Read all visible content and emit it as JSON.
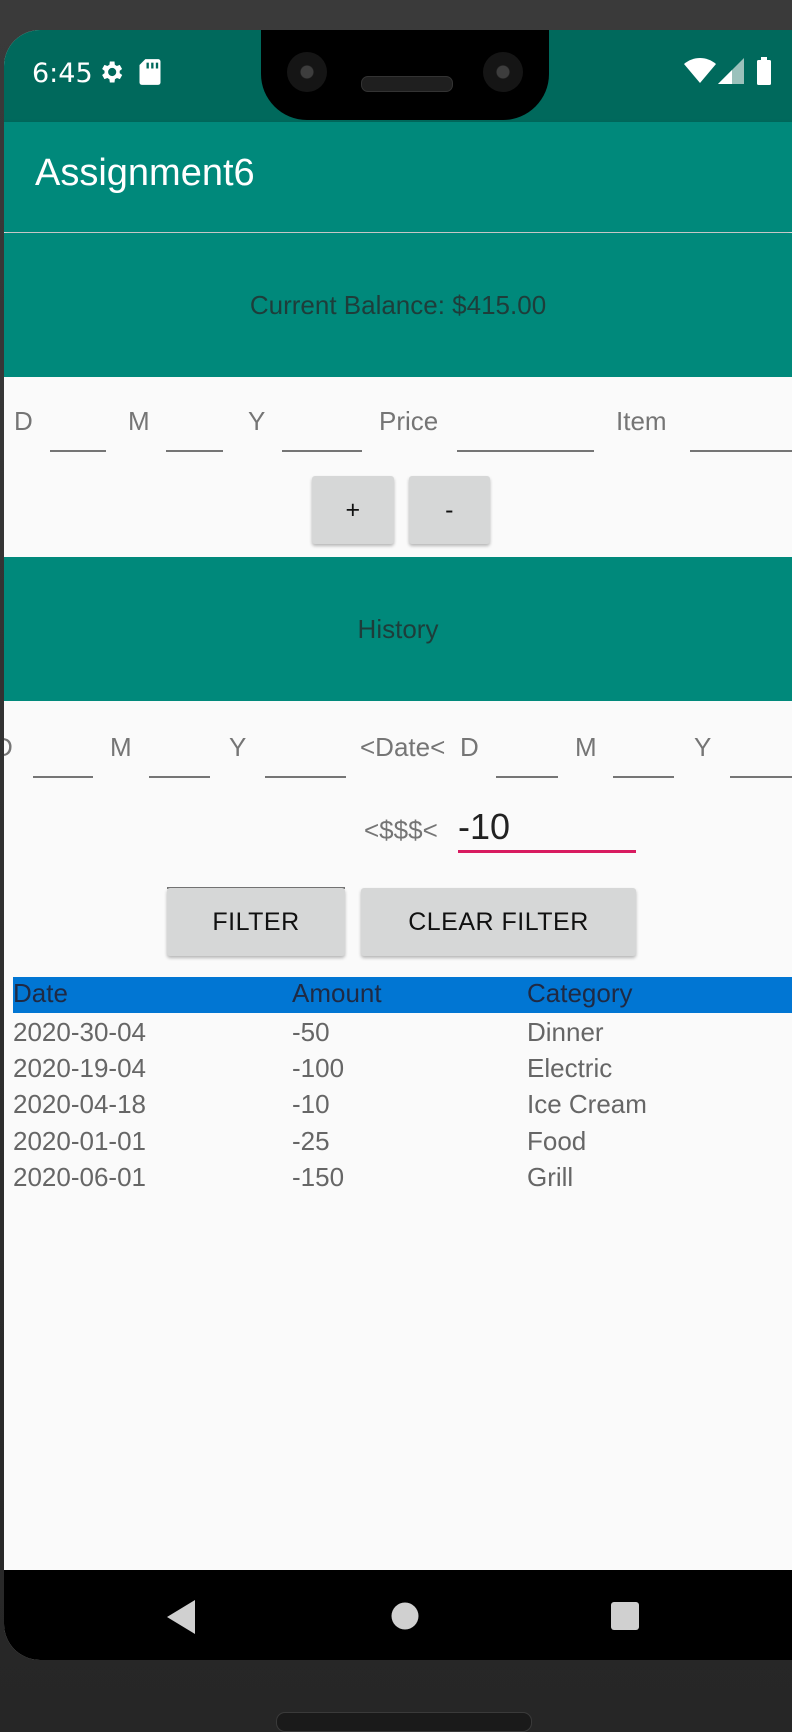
{
  "status_bar": {
    "time": "6:45",
    "icons_left": [
      "gear-icon",
      "sd-card-icon"
    ],
    "icons_right": [
      "wifi-icon",
      "signal-icon",
      "battery-icon"
    ]
  },
  "app_bar": {
    "title": "Assignment6"
  },
  "balance": {
    "text": "Current Balance: $415.00"
  },
  "entry_form": {
    "labels": {
      "day": "D",
      "month": "M",
      "year": "Y",
      "price": "Price",
      "item": "Item"
    },
    "add_label": "+",
    "subtract_label": "-"
  },
  "history": {
    "title": "History"
  },
  "filter": {
    "labels": {
      "day": "D",
      "month": "M",
      "year": "Y",
      "date_sep": "<Date<",
      "amount_sep": "<$$$<"
    },
    "amount_max_value": "-10",
    "filter_label": "FILTER",
    "clear_label": "CLEAR FILTER"
  },
  "table": {
    "headers": [
      "Date",
      "Amount",
      "Category"
    ],
    "rows": [
      [
        "2020-30-04",
        "-50",
        "Dinner"
      ],
      [
        "2020-19-04",
        "-100",
        "Electric"
      ],
      [
        "2020-04-18",
        "-10",
        "Ice Cream"
      ],
      [
        "2020-01-01",
        "-25",
        "Food"
      ],
      [
        "2020-06-01",
        "-150",
        "Grill"
      ]
    ]
  },
  "colors": {
    "status_bar": "#00695c",
    "primary": "#00897b",
    "table_header": "#0176d3",
    "accent": "#d81b60"
  }
}
